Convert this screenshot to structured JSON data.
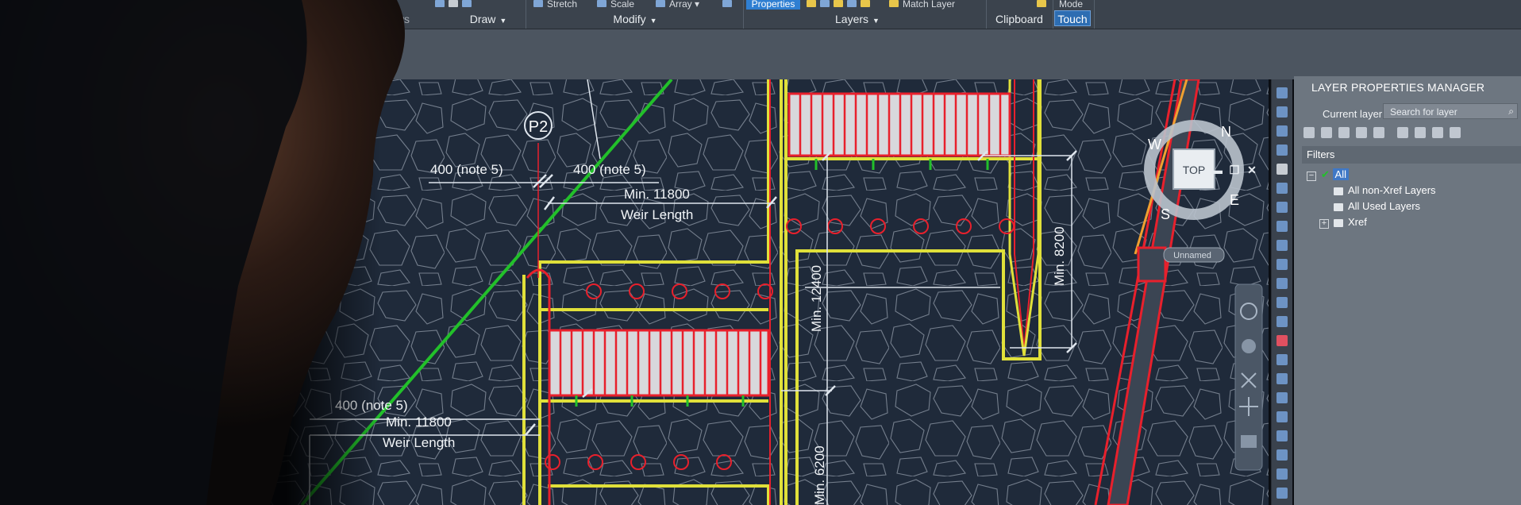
{
  "ribbon": {
    "panels": [
      {
        "label": "Draw"
      },
      {
        "label": "Modify"
      },
      {
        "label": "Layers"
      },
      {
        "label": "Clipboard"
      }
    ],
    "partial_label_left": "iews",
    "tools": {
      "stretch": "Stretch",
      "scale": "Scale",
      "array": "Array",
      "properties": "Properties",
      "match_layer": "Match Layer",
      "mode": "Mode"
    },
    "touch": "Touch"
  },
  "drawing": {
    "callout": "P2",
    "labels": {
      "note_left_top": "400 (note 5)",
      "note_right_top": "400 (note 5)",
      "min_top": "Min. 11800",
      "weir_top": "Weir Length",
      "note_lower": "400 (note 5)",
      "min_lower": "Min. 11800",
      "weir_lower": "Weir Length",
      "vert_12400": "Min. 12400",
      "vert_8200": "Min. 8200",
      "vert_6200": "Min. 6200"
    },
    "viewcube": {
      "top": "TOP",
      "n": "N",
      "e": "E",
      "s": "S",
      "w": "W",
      "ucs": "Unnamed"
    },
    "window_controls": [
      "▬",
      "❐",
      "✕"
    ]
  },
  "layer_manager": {
    "title": "LAYER PROPERTIES MANAGER",
    "current_layer": "Current layer",
    "search_placeholder": "Search for layer",
    "filters_header": "Filters",
    "tree": [
      {
        "label": "All",
        "selected": true
      },
      {
        "label": "All non-Xref Layers"
      },
      {
        "label": "All Used Layers"
      },
      {
        "label": "Xref"
      }
    ]
  },
  "colors": {
    "canvas": "#1f2a3a",
    "outline_yellow": "#e0e03a",
    "red": "#e8202c",
    "green": "#22c02a",
    "dim_white": "#dfe6ee",
    "selection_blue": "#3f78c6"
  }
}
